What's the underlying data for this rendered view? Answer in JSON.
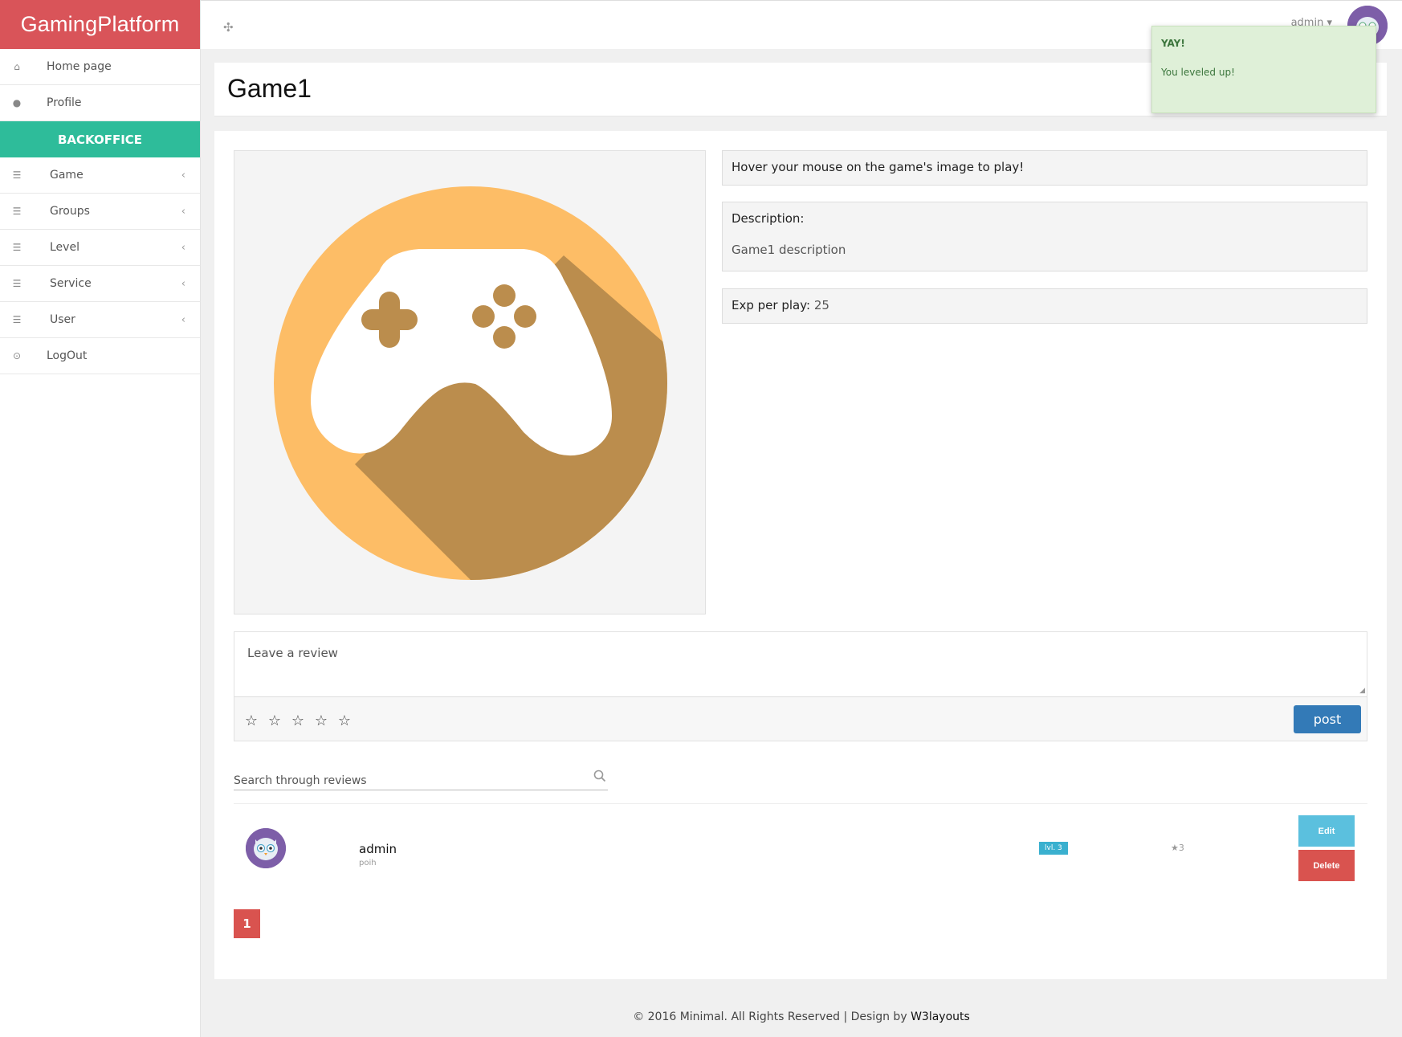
{
  "brand": "GamingPlatform",
  "sidebar": {
    "items": [
      {
        "label": "Home page",
        "icon": "home-icon"
      },
      {
        "label": "Profile",
        "icon": "user-icon"
      }
    ],
    "section_title": "BACKOFFICE",
    "backoffice_items": [
      {
        "label": "Game",
        "icon": "sliders-icon"
      },
      {
        "label": "Groups",
        "icon": "sliders-icon"
      },
      {
        "label": "Level",
        "icon": "sliders-icon"
      },
      {
        "label": "Service",
        "icon": "sliders-icon"
      },
      {
        "label": "User",
        "icon": "sliders-icon"
      }
    ],
    "logout_label": "LogOut"
  },
  "topbar": {
    "user_label": "admin",
    "caret": "▾"
  },
  "toast": {
    "title": "YAY!",
    "message": "You leveled up!"
  },
  "page_title": "Game1",
  "game_info": {
    "hint": "Hover your mouse on the game's image to play!",
    "description_label": "Description:",
    "description": "Game1 description",
    "exp_label": "Exp per play:",
    "exp_value": "25"
  },
  "review_form": {
    "placeholder": "Leave a review",
    "stars": [
      "☆",
      "☆",
      "☆",
      "☆",
      "☆"
    ],
    "post_label": "post"
  },
  "search": {
    "placeholder": "Search through reviews"
  },
  "reviews": [
    {
      "user": "admin",
      "text": "poih",
      "level": "lvl. 3",
      "rating": "★3",
      "edit_label": "Edit",
      "delete_label": "Delete"
    }
  ],
  "pagination": {
    "current": "1"
  },
  "footer": {
    "text": "© 2016 Minimal. All Rights Reserved | Design by ",
    "link": "W3layouts"
  },
  "colors": {
    "brand": "#d95459",
    "backoffice": "#2ebc9a",
    "primary": "#337ab7",
    "info": "#5bc0de",
    "danger": "#d9534f",
    "toast_bg": "#dff0d8"
  }
}
